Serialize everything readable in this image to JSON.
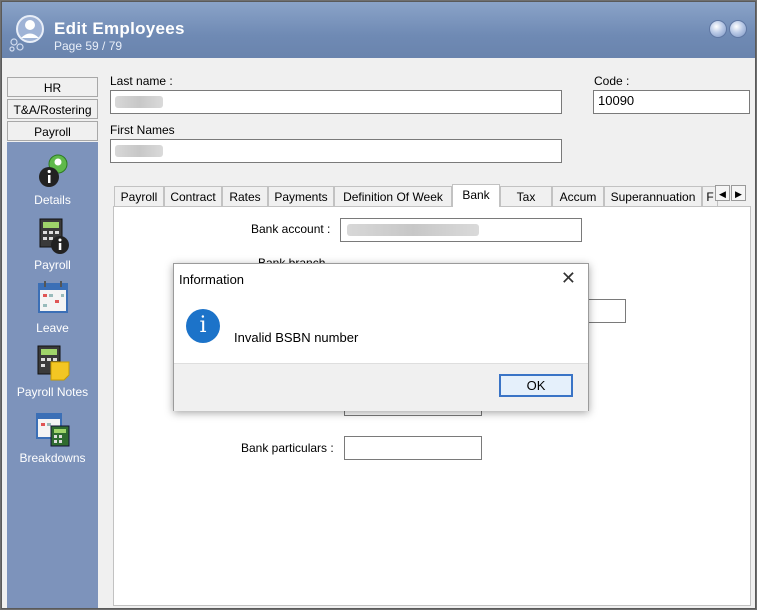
{
  "window": {
    "title": "Edit Employees",
    "subtitle": "Page 59 / 79"
  },
  "sidebar": {
    "tabs": [
      {
        "label": "HR"
      },
      {
        "label": "T&A/Rostering"
      },
      {
        "label": "Payroll"
      }
    ],
    "items": [
      {
        "label": "Details",
        "icon": "person-info-icon"
      },
      {
        "label": "Payroll",
        "icon": "calculator-info-icon"
      },
      {
        "label": "Leave",
        "icon": "calendar-icon"
      },
      {
        "label": "Payroll Notes",
        "icon": "calculator-note-icon"
      },
      {
        "label": "Breakdowns",
        "icon": "calendar-calculator-icon"
      }
    ]
  },
  "form": {
    "last_name_label": "Last name :",
    "code_label": "Code :",
    "code_value": "10090",
    "first_names_label": "First Names"
  },
  "tabs": [
    {
      "label": "Payroll"
    },
    {
      "label": "Contract"
    },
    {
      "label": "Rates"
    },
    {
      "label": "Payments"
    },
    {
      "label": "Definition Of Week"
    },
    {
      "label": "Bank"
    },
    {
      "label": "Tax"
    },
    {
      "label": "Accum"
    },
    {
      "label": "Superannuation"
    },
    {
      "label": "F"
    }
  ],
  "bank": {
    "account_label": "Bank account :",
    "partial_label": "Bank branch",
    "particulars_label": "Bank particulars :"
  },
  "dialog": {
    "title": "Information",
    "message": "Invalid BSBN number",
    "ok_label": "OK",
    "close_glyph": "✕",
    "icon_glyph": "i"
  },
  "colors": {
    "title_bar": "#6f8ab4",
    "sidebar_panel": "#7d93bb",
    "info_icon": "#1c73c9",
    "ok_border": "#3a74c6"
  }
}
